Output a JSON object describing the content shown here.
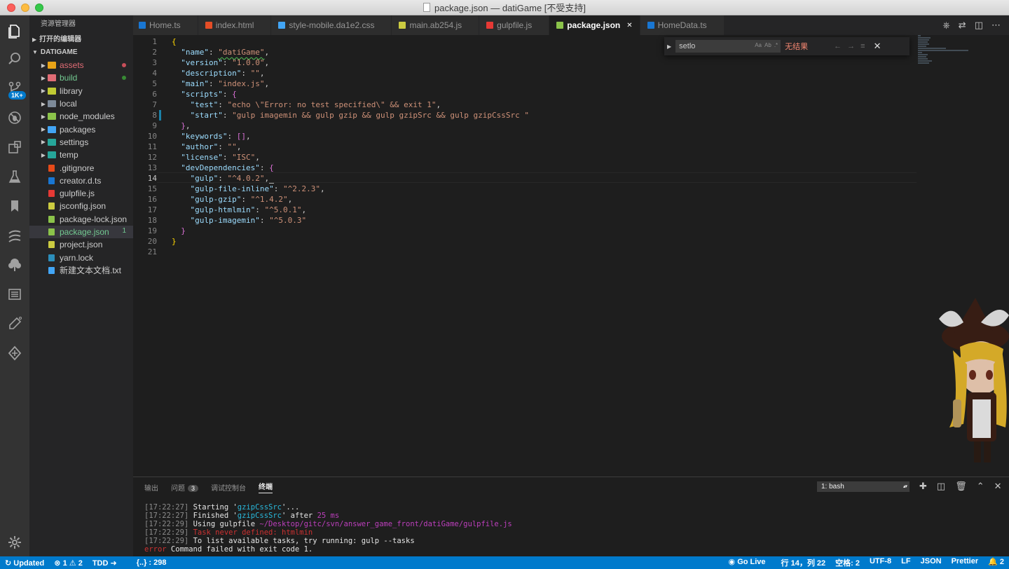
{
  "window": {
    "title": "package.json — datiGame [不受支持]"
  },
  "activity": {
    "scm_badge": "1K+"
  },
  "sidebar": {
    "title": "资源管理器",
    "open_editors": "打开的编辑器",
    "project": "DATIGAME",
    "items": [
      {
        "label": "assets",
        "type": "folder",
        "icon_color": "#e8a317",
        "label_color": "#e06c75",
        "dot": "#c74e59"
      },
      {
        "label": "build",
        "type": "folder",
        "icon_color": "#e06c75",
        "label_color": "#73c991",
        "dot": "#388a34"
      },
      {
        "label": "library",
        "type": "folder",
        "icon_color": "#c0ca33",
        "label_color": "#cccccc"
      },
      {
        "label": "local",
        "type": "folder",
        "icon_color": "#7d8a99",
        "label_color": "#cccccc"
      },
      {
        "label": "node_modules",
        "type": "folder",
        "icon_color": "#8bc34a",
        "label_color": "#cccccc"
      },
      {
        "label": "packages",
        "type": "folder",
        "icon_color": "#42a5f5",
        "label_color": "#cccccc"
      },
      {
        "label": "settings",
        "type": "folder",
        "icon_color": "#26a69a",
        "label_color": "#cccccc"
      },
      {
        "label": "temp",
        "type": "folder",
        "icon_color": "#26a69a",
        "label_color": "#cccccc"
      },
      {
        "label": ".gitignore",
        "type": "file",
        "icon_color": "#e64a19",
        "label_color": "#cccccc"
      },
      {
        "label": "creator.d.ts",
        "type": "file",
        "icon_color": "#1976d2",
        "label_color": "#cccccc"
      },
      {
        "label": "gulpfile.js",
        "type": "file",
        "icon_color": "#e53935",
        "label_color": "#cccccc"
      },
      {
        "label": "jsconfig.json",
        "type": "file",
        "icon_color": "#cbcb41",
        "label_color": "#cccccc"
      },
      {
        "label": "package-lock.json",
        "type": "file",
        "icon_color": "#8bc34a",
        "label_color": "#cccccc"
      },
      {
        "label": "package.json",
        "type": "file",
        "icon_color": "#8bc34a",
        "label_color": "#73c991",
        "count": "1",
        "selected": true
      },
      {
        "label": "project.json",
        "type": "file",
        "icon_color": "#cbcb41",
        "label_color": "#cccccc"
      },
      {
        "label": "yarn.lock",
        "type": "file",
        "icon_color": "#2c8ebb",
        "label_color": "#cccccc"
      },
      {
        "label": "新建文本文档.txt",
        "type": "file",
        "icon_color": "#42a5f5",
        "label_color": "#cccccc"
      }
    ]
  },
  "tabs": [
    {
      "label": "Home.ts",
      "icon_color": "#1976d2",
      "active": false
    },
    {
      "label": "index.html",
      "icon_color": "#e44d26",
      "active": false
    },
    {
      "label": "style-mobile.da1e2.css",
      "icon_color": "#42a5f5",
      "active": false
    },
    {
      "label": "main.ab254.js",
      "icon_color": "#cbcb41",
      "active": false
    },
    {
      "label": "gulpfile.js",
      "icon_color": "#e53935",
      "active": false
    },
    {
      "label": "package.json",
      "icon_color": "#8bc34a",
      "active": true
    },
    {
      "label": "HomeData.ts",
      "icon_color": "#1976d2",
      "active": false
    }
  ],
  "editor": {
    "line_numbers": [
      "1",
      "2",
      "3",
      "4",
      "5",
      "6",
      "7",
      "8",
      "9",
      "10",
      "11",
      "12",
      "13",
      "14",
      "15",
      "16",
      "17",
      "18",
      "19",
      "20",
      "21"
    ],
    "current_line": 14
  },
  "find": {
    "value": "setlo",
    "result": "无结果"
  },
  "panel": {
    "tabs": [
      {
        "label": "输出"
      },
      {
        "label": "问题",
        "badge": "3"
      },
      {
        "label": "调试控制台"
      },
      {
        "label": "终端",
        "active": true
      }
    ],
    "terminal_select": "1: bash",
    "terminal": [
      {
        "time": "17:22:27",
        "pre": "Starting '",
        "hl": "gzipCssSrc",
        "post": "'..."
      },
      {
        "time": "17:22:27",
        "pre": "Finished '",
        "hl": "gzipCssSrc",
        "post": "' after ",
        "num": "25 ms"
      },
      {
        "time": "17:22:29",
        "pre": "Using gulpfile ",
        "path": "~/Desktop/gitc/svn/answer_game_front/datiGame/gulpfile.js"
      },
      {
        "time": "17:22:29",
        "err": "Task never defined: htmlmin"
      },
      {
        "time": "17:22:29",
        "pre": "To list available tasks, try running: gulp --tasks"
      }
    ],
    "error_prefix": "error",
    "error_line": " Command failed with exit code 1."
  },
  "status": {
    "sync": "Updated",
    "errors": "1",
    "warnings": "2",
    "tdd": "TDD",
    "json_info": "{..} : 298",
    "golive": "Go Live",
    "position": "行 14，列 22",
    "spaces": "空格: 2",
    "encoding": "UTF-8",
    "eol": "LF",
    "language": "JSON",
    "prettier": "Prettier",
    "notifications": "2"
  }
}
